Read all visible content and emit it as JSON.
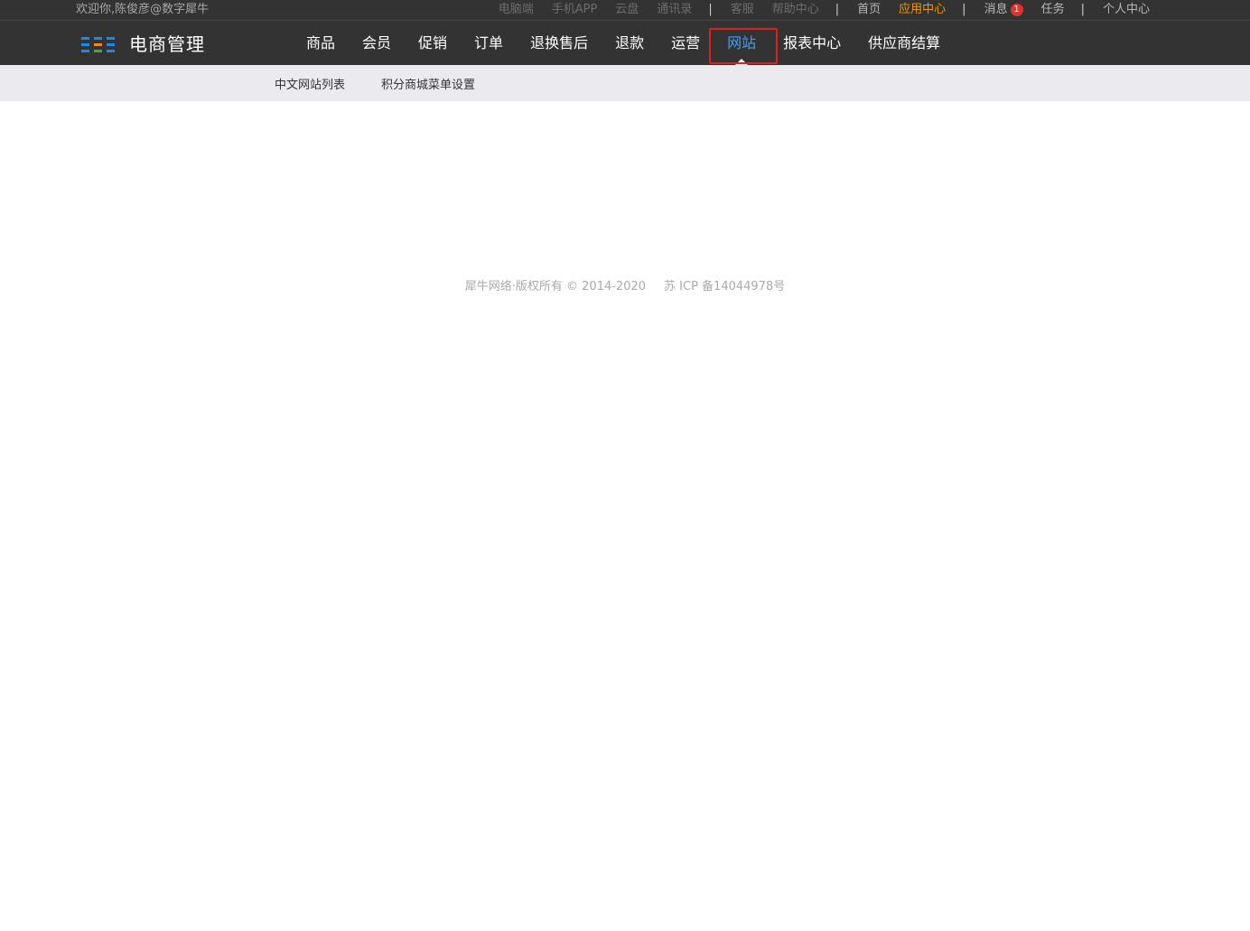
{
  "topbar": {
    "welcome": "欢迎你,陈俊彦@数字犀牛",
    "links_group1": [
      "电脑端",
      "手机APP",
      "云盘",
      "通讯录"
    ],
    "links_group2": [
      "客服",
      "帮助中心"
    ],
    "home": "首页",
    "app_center": "应用中心",
    "messages": "消息",
    "message_count": "1",
    "tasks": "任务",
    "personal_center": "个人中心",
    "separator": "|"
  },
  "logo": {
    "title": "电商管理",
    "icon": "grid-logo-icon"
  },
  "nav": {
    "items": [
      "商品",
      "会员",
      "促销",
      "订单",
      "退换售后",
      "退款",
      "运营",
      "网站",
      "报表中心",
      "供应商结算"
    ],
    "active": "网站"
  },
  "subnav": {
    "items": [
      "中文网站列表",
      "积分商城菜单设置"
    ]
  },
  "footer": {
    "copyright": "犀牛网络·版权所有 © 2014-2020",
    "icp": "苏 ICP 备14044978号"
  },
  "colors": {
    "header_bg": "#333333",
    "active_nav": "#3aa0ff",
    "accent": "#f39800",
    "badge": "#e4312b",
    "highlight_border": "#e02020",
    "subnav_bg": "#ebebef"
  }
}
